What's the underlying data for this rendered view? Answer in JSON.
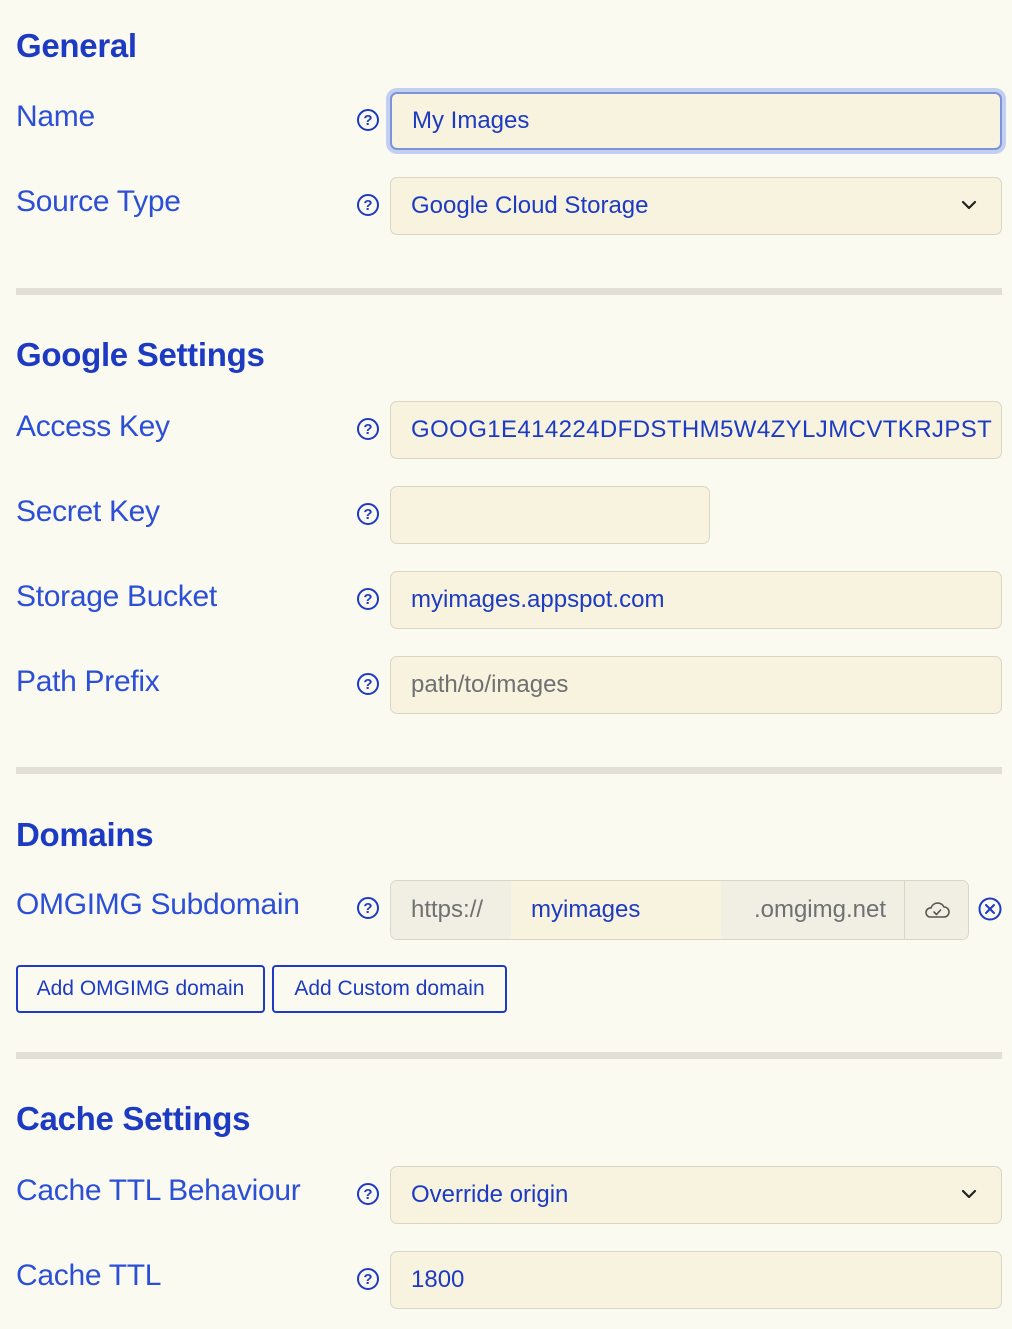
{
  "help_glyph": "?",
  "general": {
    "title": "General",
    "name_label": "Name",
    "name_value": "My Images",
    "source_type_label": "Source Type",
    "source_type_value": "Google Cloud Storage"
  },
  "google": {
    "title": "Google Settings",
    "access_key_label": "Access Key",
    "access_key_value": "GOOG1E414224DFDSTHM5W4ZYLJMCVTKRJPST",
    "secret_key_label": "Secret Key",
    "secret_key_value": "",
    "bucket_label": "Storage Bucket",
    "bucket_value": "myimages.appspot.com",
    "path_prefix_label": "Path Prefix",
    "path_prefix_placeholder": "path/to/images"
  },
  "domains": {
    "title": "Domains",
    "subdomain_label": "OMGIMG Subdomain",
    "subdomain_prefix": "https://",
    "subdomain_value": "myimages",
    "subdomain_suffix": ".omgimg.net",
    "add_omgimg_label": "Add OMGIMG domain",
    "add_custom_label": "Add Custom domain"
  },
  "cache": {
    "title": "Cache Settings",
    "ttl_behaviour_label": "Cache TTL Behaviour",
    "ttl_behaviour_value": "Override origin",
    "ttl_label": "Cache TTL",
    "ttl_value": "1800"
  },
  "colors": {
    "accent": "#1d3bc2",
    "background": "#fbfaf1",
    "field_bg": "#f7f3df",
    "divider": "#e2e0d6"
  },
  "icons": {
    "help": "question-circle-icon",
    "select": "chevron-down-icon",
    "verify": "cloud-icon",
    "remove": "close-circle-icon"
  }
}
